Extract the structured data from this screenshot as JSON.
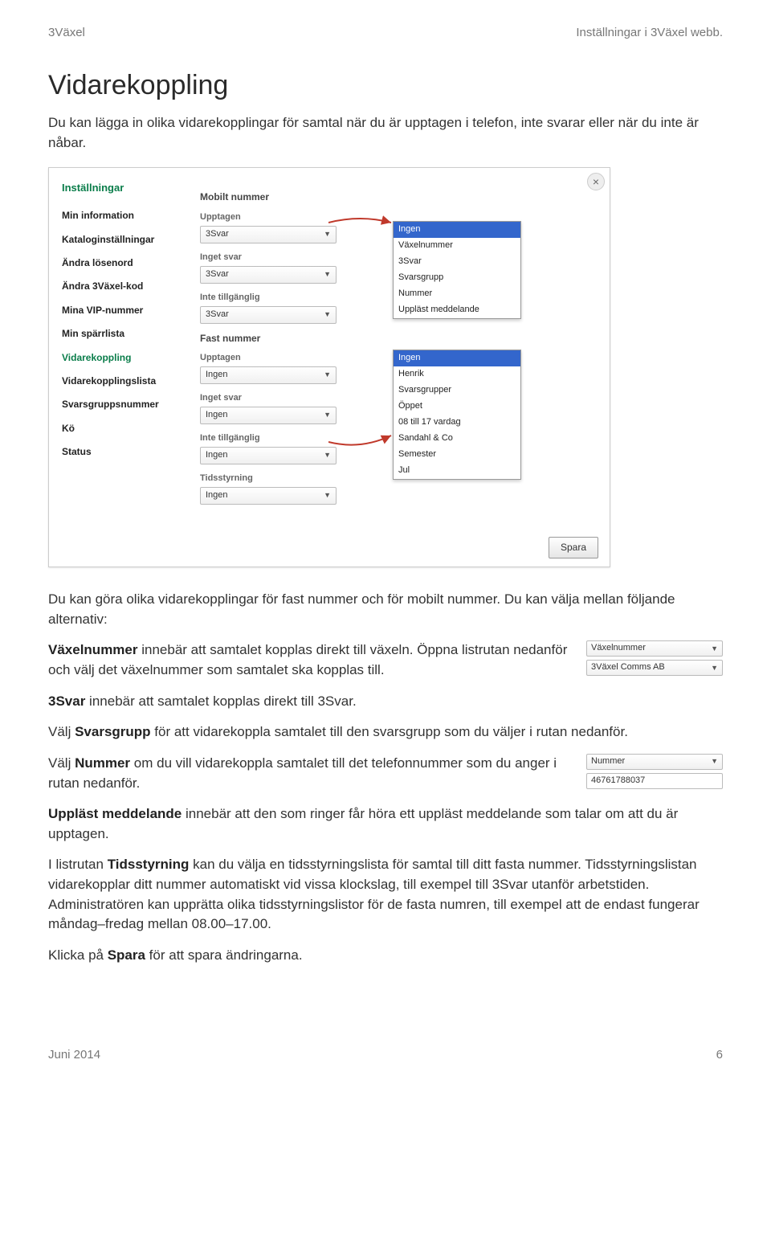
{
  "header": {
    "left": "3Växel",
    "right": "Inställningar i 3Växel webb."
  },
  "title": "Vidarekoppling",
  "intro": "Du kan lägga in olika vidarekopplingar för samtal när du är upptagen i telefon, inte svarar eller när du inte är nåbar.",
  "screenshot": {
    "settings_heading": "Inställningar",
    "sidebar": [
      "Min information",
      "Kataloginställningar",
      "Ändra lösenord",
      "Ändra 3Växel-kod",
      "Mina VIP-nummer",
      "Min spärrlista",
      "Vidarekoppling",
      "Vidarekopplingslista",
      "Svarsgruppsnummer",
      "Kö",
      "Status"
    ],
    "active_index": 6,
    "mobile_heading": "Mobilt nummer",
    "fast_heading": "Fast nummer",
    "labels": {
      "upptagen": "Upptagen",
      "inget_svar": "Inget svar",
      "inte_tillg": "Inte tillgänglig",
      "tidsstyrning": "Tidsstyrning"
    },
    "values": {
      "mobile_upptagen": "3Svar",
      "mobile_inget_svar": "3Svar",
      "mobile_inte_tillg": "3Svar",
      "fast_upptagen": "Ingen",
      "fast_inget_svar": "Ingen",
      "fast_inte_tillg": "Ingen",
      "fast_tidsstyrning": "Ingen"
    },
    "popup1": [
      "Ingen",
      "Växelnummer",
      "3Svar",
      "Svarsgrupp",
      "Nummer",
      "Uppläst meddelande"
    ],
    "popup2": [
      "Ingen",
      "Henrik",
      "Svarsgrupper",
      "Öppet",
      "08 till 17 vardag",
      "Sandahl & Co",
      "Semester",
      "Jul"
    ],
    "spara": "Spara"
  },
  "body": {
    "p1": "Du kan göra olika vidarekopplingar för fast nummer och för mobilt nummer. Du kan välja mellan följande alternativ:",
    "vaxel_label": "Växelnummer",
    "vaxel_rest": " innebär att samtalet kopplas direkt till växeln. Öppna listrutan nedanför och välj det växelnummer som samtalet ska kopplas till.",
    "mini1_label": "Växelnummer",
    "mini1_value": "3Växel Comms AB",
    "p3_label": "3Svar",
    "p3_rest": " innebär att samtalet kopplas direkt till 3Svar.",
    "p4_pre": "Välj ",
    "p4_label": "Svarsgrupp",
    "p4_rest": " för att vidarekoppla samtalet till den svarsgrupp som du väljer i rutan nedanför.",
    "p5_pre": "Välj ",
    "p5_label": "Nummer",
    "p5_rest": " om du vill vidarekoppla samtalet till det telefonnummer som du anger i rutan nedanför.",
    "mini2_label": "Nummer",
    "mini2_value": "46761788037",
    "p6_label": "Uppläst meddelande",
    "p6_rest": " innebär att den som ringer får höra ett uppläst meddelande som talar om att du är upptagen.",
    "p7_pre": "I listrutan ",
    "p7_label": "Tidsstyrning",
    "p7_rest": " kan du välja en tidsstyrningslista för samtal till ditt fasta nummer. Tidsstyrningslistan vidarekopplar ditt nummer automatiskt vid vissa klockslag, till exempel till 3Svar utanför arbetstiden. Administratören kan upprätta olika tidsstyrningslistor för de fasta numren, till exempel att de endast fungerar måndag–fredag mellan 08.00–17.00.",
    "p8_pre": "Klicka på ",
    "p8_label": "Spara",
    "p8_rest": " för att spara ändringarna."
  },
  "footer": {
    "left": "Juni 2014",
    "right": "6"
  }
}
